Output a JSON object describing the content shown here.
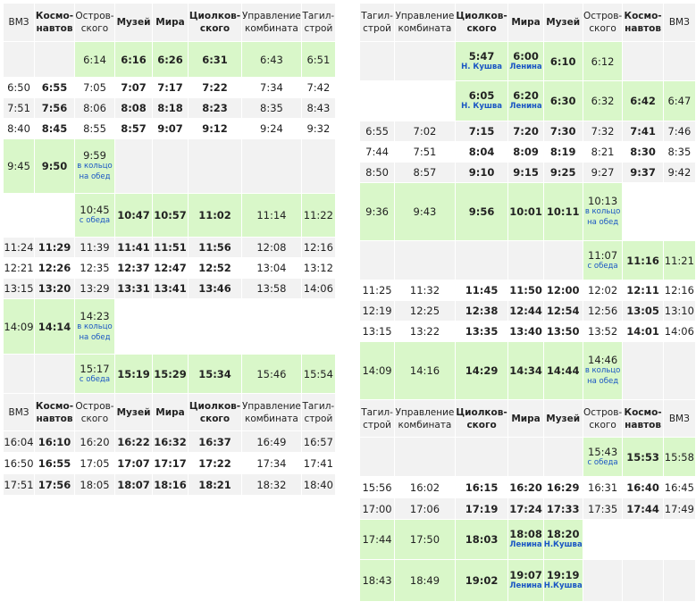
{
  "left": {
    "headers": [
      "ВМЗ",
      "Космо-\nнавтов",
      "Остров-\nского",
      "Музей",
      "Мира",
      "Циолков-\nского",
      "Управление\nкомбината",
      "Тагил-\nстрой"
    ],
    "rows": [
      [
        "",
        "",
        "6:14",
        "6:16",
        "6:26",
        "6:31",
        "6:43",
        "6:51"
      ],
      [
        "6:50",
        "6:55",
        "7:05",
        "7:07",
        "7:17",
        "7:22",
        "7:34",
        "7:42"
      ],
      [
        "7:51",
        "7:56",
        "8:06",
        "8:08",
        "8:18",
        "8:23",
        "8:35",
        "8:43"
      ],
      [
        "8:40",
        "8:45",
        "8:55",
        "8:57",
        "9:07",
        "9:12",
        "9:24",
        "9:32"
      ],
      [
        "9:45",
        "9:50",
        "9:59",
        "",
        "",
        "",
        "",
        ""
      ],
      [
        "",
        "",
        "10:45",
        "10:47",
        "10:57",
        "11:02",
        "11:14",
        "11:22"
      ],
      [
        "11:24",
        "11:29",
        "11:39",
        "11:41",
        "11:51",
        "11:56",
        "12:08",
        "12:16"
      ],
      [
        "12:21",
        "12:26",
        "12:35",
        "12:37",
        "12:47",
        "12:52",
        "13:04",
        "13:12"
      ],
      [
        "13:15",
        "13:20",
        "13:29",
        "13:31",
        "13:41",
        "13:46",
        "13:58",
        "14:06"
      ],
      [
        "14:09",
        "14:14",
        "14:23",
        "",
        "",
        "",
        "",
        ""
      ],
      [
        "",
        "",
        "15:17",
        "15:19",
        "15:29",
        "15:34",
        "15:46",
        "15:54"
      ],
      [
        "16:04",
        "16:10",
        "16:20",
        "16:22",
        "16:32",
        "16:37",
        "16:49",
        "16:57"
      ],
      [
        "16:50",
        "16:55",
        "17:05",
        "17:07",
        "17:17",
        "17:22",
        "17:34",
        "17:41"
      ],
      [
        "17:51",
        "17:56",
        "18:05",
        "18:07",
        "18:16",
        "18:21",
        "18:32",
        "18:40"
      ]
    ],
    "notes": {
      "r4c2": "в кольцо\nна обед",
      "r5c2": "с обеда",
      "r9c2": "в кольцо\nна обед",
      "r10c2": "с обеда"
    }
  },
  "right": {
    "headers": [
      "Тагил-\nстрой",
      "Управление\nкомбината",
      "Циолков-\nского",
      "Мира",
      "Музей",
      "Остров-\nского",
      "Космо-\nнавтов",
      "ВМЗ"
    ],
    "rows": [
      [
        "",
        "",
        "5:47",
        "6:00",
        "6:10",
        "6:12",
        "",
        ""
      ],
      [
        "",
        "",
        "6:05",
        "6:20",
        "6:30",
        "6:32",
        "6:42",
        "6:47"
      ],
      [
        "6:55",
        "7:02",
        "7:15",
        "7:20",
        "7:30",
        "7:32",
        "7:41",
        "7:46"
      ],
      [
        "7:44",
        "7:51",
        "8:04",
        "8:09",
        "8:19",
        "8:21",
        "8:30",
        "8:35"
      ],
      [
        "8:50",
        "8:57",
        "9:10",
        "9:15",
        "9:25",
        "9:27",
        "9:37",
        "9:42"
      ],
      [
        "9:36",
        "9:43",
        "9:56",
        "10:01",
        "10:11",
        "10:13",
        "",
        ""
      ],
      [
        "",
        "",
        "",
        "",
        "",
        "11:07",
        "11:16",
        "11:21"
      ],
      [
        "11:25",
        "11:32",
        "11:45",
        "11:50",
        "12:00",
        "12:02",
        "12:11",
        "12:16"
      ],
      [
        "12:19",
        "12:25",
        "12:38",
        "12:44",
        "12:54",
        "12:56",
        "13:05",
        "13:10"
      ],
      [
        "13:15",
        "13:22",
        "13:35",
        "13:40",
        "13:50",
        "13:52",
        "14:01",
        "14:06"
      ],
      [
        "14:09",
        "14:16",
        "14:29",
        "14:34",
        "14:44",
        "14:46",
        "",
        ""
      ],
      [
        "",
        "",
        "",
        "",
        "",
        "15:43",
        "15:53",
        "15:58"
      ],
      [
        "15:56",
        "16:02",
        "16:15",
        "16:20",
        "16:29",
        "16:31",
        "16:40",
        "16:45"
      ],
      [
        "17:00",
        "17:06",
        "17:19",
        "17:24",
        "17:33",
        "17:35",
        "17:44",
        "17:49"
      ],
      [
        "17:44",
        "17:50",
        "18:03",
        "18:08",
        "18:20",
        "",
        "",
        ""
      ],
      [
        "18:43",
        "18:49",
        "19:02",
        "19:07",
        "19:19",
        "",
        "",
        ""
      ]
    ],
    "notes": {
      "r0c2": "Н. Кушва",
      "r0c3": "Ленина",
      "r1c2": "Н. Кушва",
      "r1c3": "Ленина",
      "r5c5": "в кольцо\nна обед",
      "r6c5": "с обеда",
      "r10c5": "в кольцо\nна обед",
      "r11c5": "с обеда",
      "r14c3": "Ленина",
      "r14c4": "Н.Кушва",
      "r15c3": "Ленина",
      "r15c4": "Н.Кушва"
    }
  },
  "colors": {
    "highlight": "#d9f7c9",
    "row_gray": "#f2f2f2",
    "note_blue": "#1a56c4",
    "frame": "#cccccc"
  }
}
